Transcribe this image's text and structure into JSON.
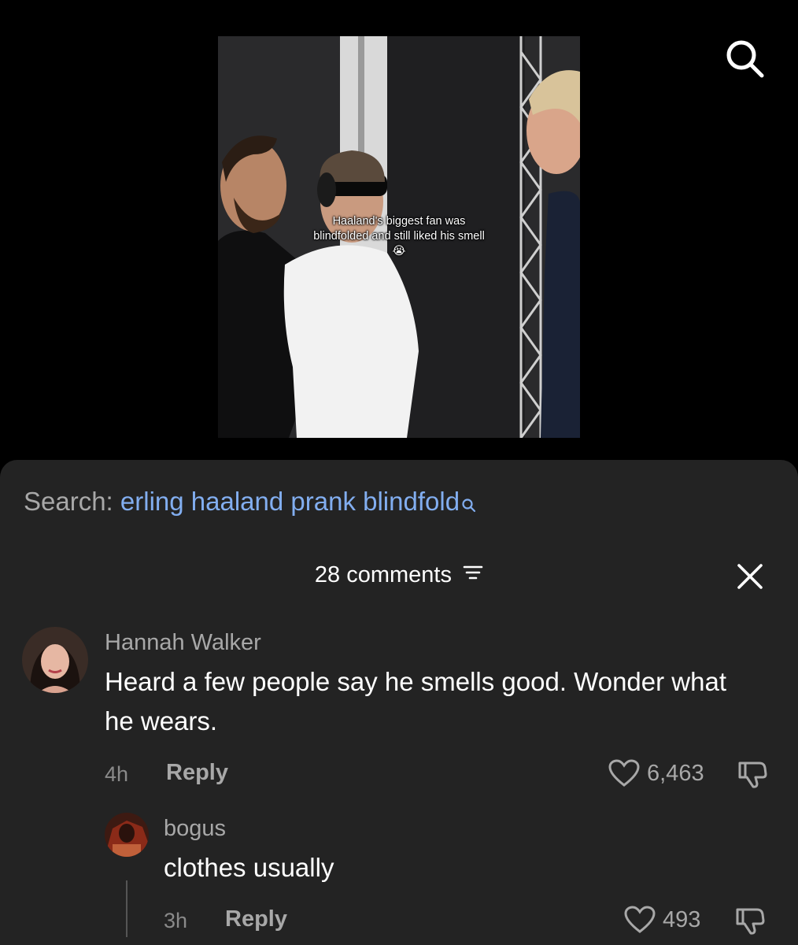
{
  "video": {
    "caption": "Haaland's biggest fan was blindfolded and still liked his smell 😭"
  },
  "search_bar": {
    "prefix": "Search:",
    "query": "erling haaland prank blindfold"
  },
  "comments_header": {
    "label": "28 comments"
  },
  "comments": [
    {
      "author": "Hannah Walker",
      "text": "Heard a few people say he smells good. Wonder what he wears.",
      "time": "4h",
      "reply_label": "Reply",
      "likes": "6,463"
    },
    {
      "author": "bogus",
      "text": "clothes usually",
      "time": "3h",
      "reply_label": "Reply",
      "likes": "493"
    }
  ],
  "colors": {
    "sheet_bg": "#232323",
    "query_link": "#82aef0",
    "muted_text": "#a8a8a8"
  },
  "icons": [
    "search-icon",
    "sort-icon",
    "close-icon",
    "heart-icon",
    "dislike-icon"
  ]
}
